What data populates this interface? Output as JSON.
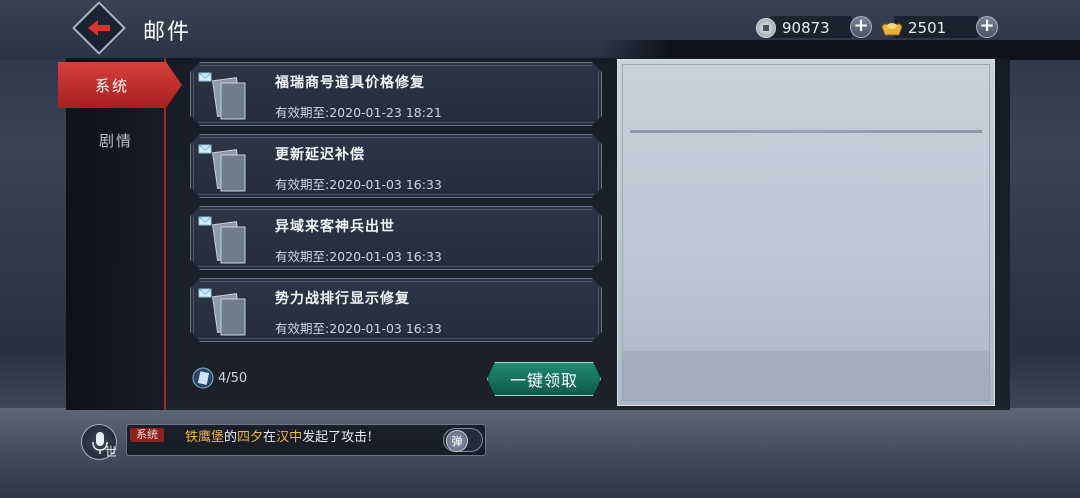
{
  "header": {
    "title": "邮件",
    "back_icon": "back-arrow-icon",
    "silver_amount": "90873",
    "gold_amount": "2501"
  },
  "sidebar": {
    "tabs": [
      {
        "label": "系统",
        "active": true
      },
      {
        "label": "剧情",
        "active": false
      }
    ]
  },
  "mail_list": {
    "items": [
      {
        "title": "福瑞商号道具价格修复",
        "expiry": "有效期至:2020-01-23 18:21"
      },
      {
        "title": "更新延迟补偿",
        "expiry": "有效期至:2020-01-03 16:33"
      },
      {
        "title": "异域来客神兵出世",
        "expiry": "有效期至:2020-01-03 16:33"
      },
      {
        "title": "势力战排行显示修复",
        "expiry": "有效期至:2020-01-03 16:33"
      }
    ],
    "count": "4/50",
    "claim_all_label": "一键领取"
  },
  "chat": {
    "channel": "系统",
    "world_label": "世",
    "message_parts": [
      "铁鹰堡",
      "的",
      "四夕",
      "在",
      "汉中",
      "发起了攻击!"
    ],
    "popup_label": "弹"
  },
  "colors": {
    "accent_red": "#c0302c",
    "claim_green": "#1f8a74",
    "highlight_gold": "#f0b73a"
  }
}
